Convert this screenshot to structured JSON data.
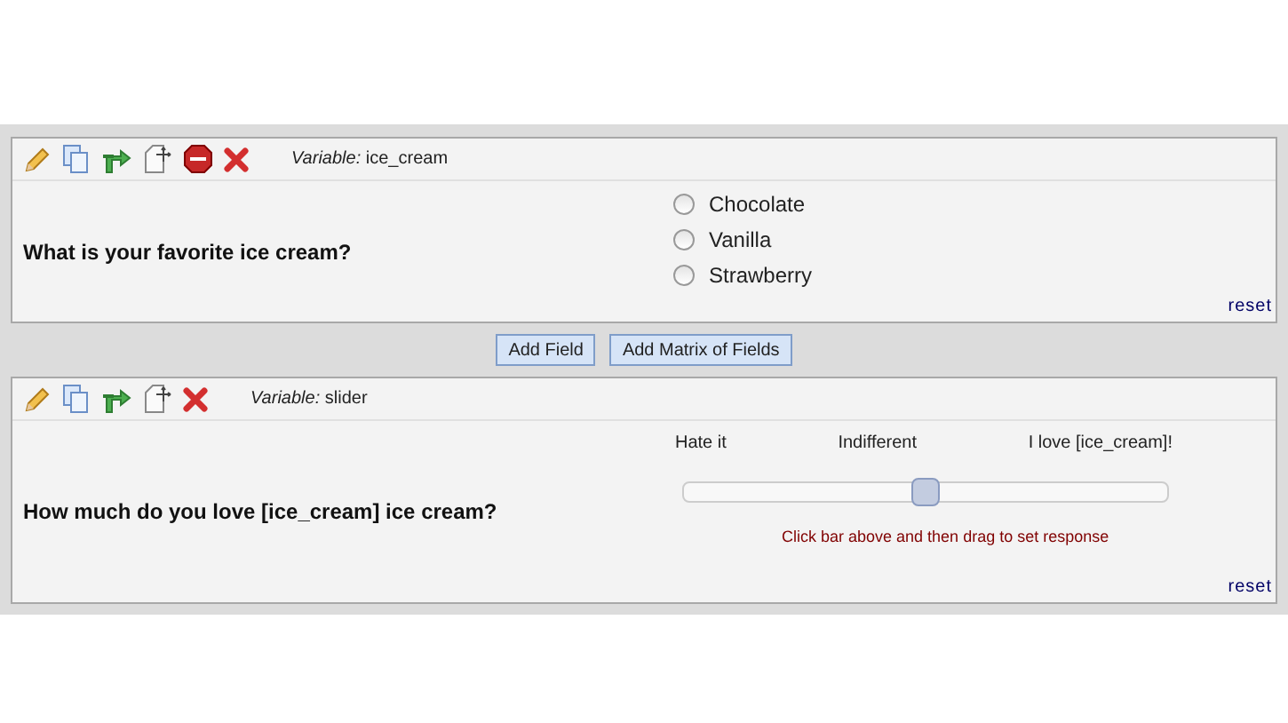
{
  "fields": [
    {
      "kind": "radio",
      "variable_label": "Variable:",
      "variable": "ice_cream",
      "stop_icon": true,
      "question": "What is your favorite ice cream?",
      "options": [
        {
          "label": "Chocolate",
          "selected": false
        },
        {
          "label": "Vanilla",
          "selected": false
        },
        {
          "label": "Strawberry",
          "selected": false
        }
      ],
      "reset": "reset"
    },
    {
      "kind": "slider",
      "variable_label": "Variable:",
      "variable": "slider",
      "stop_icon": false,
      "question": "How much do you love [ice_cream] ice cream?",
      "slider_labels": [
        "Hate it",
        "Indifferent",
        "I love [ice_cream]!"
      ],
      "level": 0.5,
      "hint": "Click bar above and then drag to set response",
      "reset": "reset"
    }
  ],
  "buttons": [
    "Add Field",
    "Add Matrix of Fields"
  ]
}
